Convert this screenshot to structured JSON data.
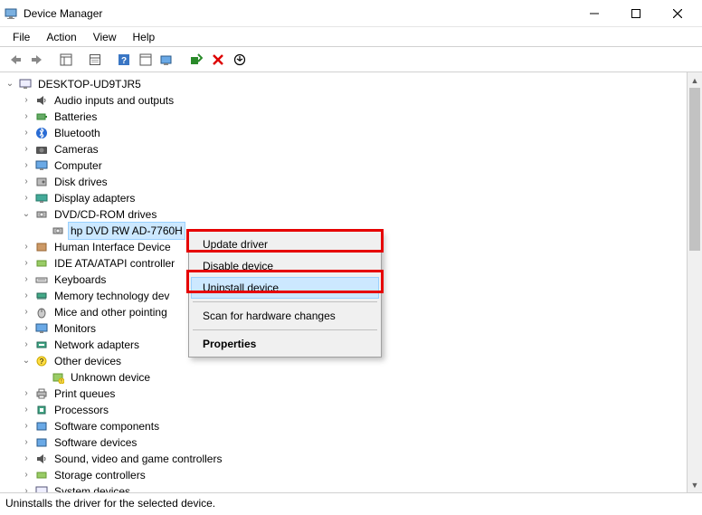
{
  "window": {
    "title": "Device Manager"
  },
  "menu": {
    "file": "File",
    "action": "Action",
    "view": "View",
    "help": "Help"
  },
  "tree": {
    "root": "DESKTOP-UD9TJR5",
    "items": [
      "Audio inputs and outputs",
      "Batteries",
      "Bluetooth",
      "Cameras",
      "Computer",
      "Disk drives",
      "Display adapters",
      "DVD/CD-ROM drives",
      "Human Interface Device",
      "IDE ATA/ATAPI controller",
      "Keyboards",
      "Memory technology dev",
      "Mice and other pointing",
      "Monitors",
      "Network adapters",
      "Other devices",
      "Unknown device",
      "Print queues",
      "Processors",
      "Software components",
      "Software devices",
      "Sound, video and game controllers",
      "Storage controllers",
      "System devices"
    ],
    "selected": "hp     DVD RW AD-7760H"
  },
  "context_menu": {
    "update": "Update driver",
    "disable": "Disable device",
    "uninstall": "Uninstall device",
    "scan": "Scan for hardware changes",
    "properties": "Properties"
  },
  "status": "Uninstalls the driver for the selected device."
}
